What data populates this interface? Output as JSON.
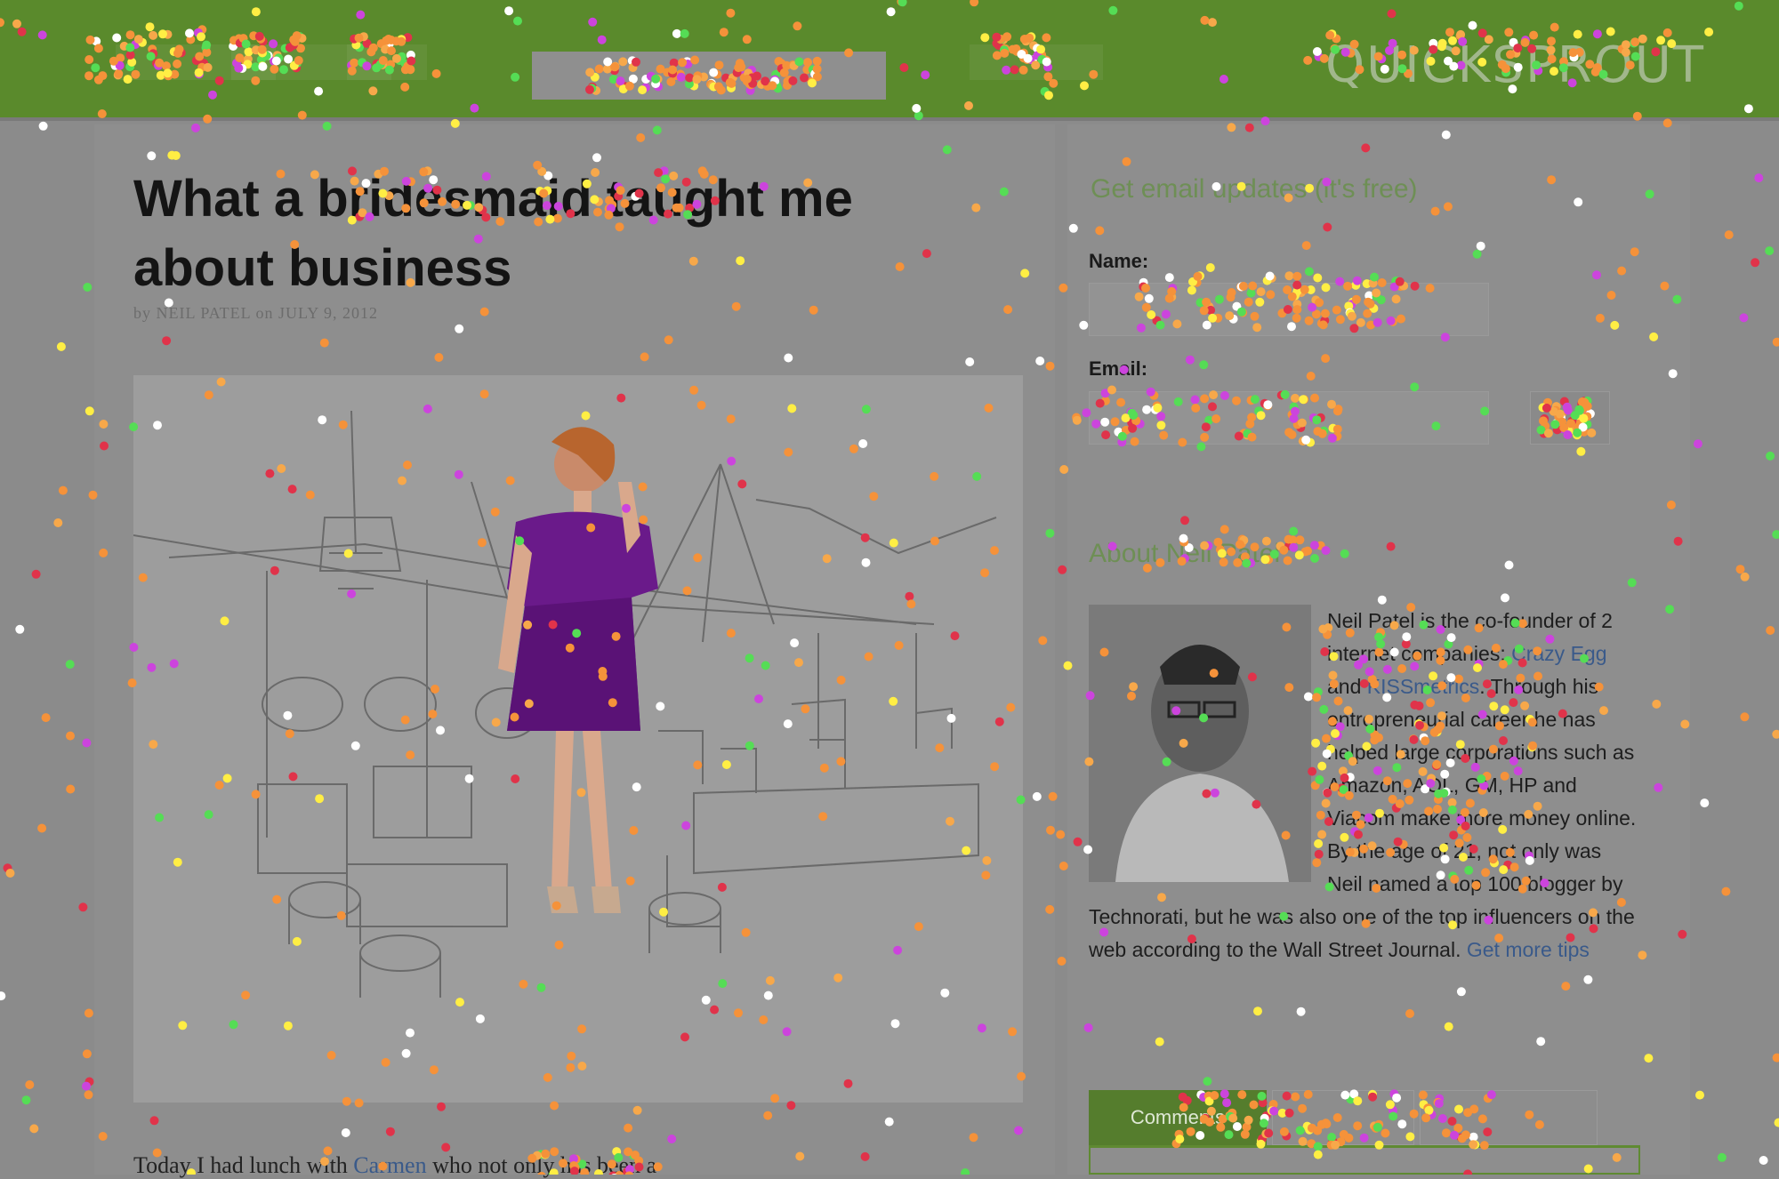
{
  "site": {
    "logo_text": "QUICKSPROUT",
    "nav": {
      "search_placeholder": ""
    }
  },
  "post": {
    "title_line1": "What a bridesmaid taught me",
    "title_line2": "about business",
    "meta": "by NEIL PATEL on JULY 9, 2012",
    "body_intro": "Today I had lunch with ",
    "body_link": "Carmen",
    "body_rest": " who not only has been a"
  },
  "sidebar": {
    "email_widget": {
      "title": "Get email updates (it's free)",
      "name_label": "Name:",
      "email_label": "Email:",
      "name_value": "",
      "email_value": "",
      "submit_label": ""
    },
    "about_widget": {
      "title": "About Neil Patel",
      "bio_part1": "Neil Patel is the co-founder of 2 internet companies: ",
      "link1": "Crazy Egg",
      "and": " and ",
      "link2": "KISSmetrics",
      "bio_part2": ". Through his entrepreneurial career he has helped large corporations such as Amazon, AOL, GM, HP and Viacom make more money online. By the age of 21, not only was Neil named a top 100 blogger by Technorati, but he was also one of the top influencers on the web according to the Wall Street Journal. ",
      "link3": "Get more tips"
    },
    "tabs": [
      {
        "label": "Comments"
      },
      {
        "label": ""
      },
      {
        "label": ""
      }
    ]
  },
  "colors": {
    "nav_green": "#5a8a2c",
    "page_gray": "#8b8b8b",
    "dress_purple": "#6a1a8a",
    "gaze_orange": "#f5923a"
  }
}
